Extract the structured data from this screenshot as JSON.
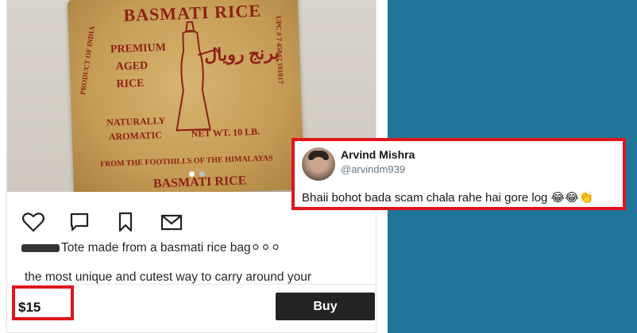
{
  "product": {
    "image_texts": {
      "brand": "BASMATI RICE",
      "line1": "PREMIUM",
      "line2": "AGED",
      "line3": "RICE",
      "naturally": "NATURALLY",
      "aromatic": "AROMATIC",
      "net_wt": "NET WT. 10 LB.",
      "foothills": "FROM THE FOOTHILLS OF THE HIMALAYAS",
      "product_of": "PRODUCT OF INDIA",
      "upc": "UPC # 7 45042 101017",
      "arabic": "برنج رويال",
      "bottom": "BASMATI RICE"
    },
    "caption_line1": "Tote made from a basmati rice bag",
    "caption_emojis": "⚪⚪⚪",
    "caption_line2": "the most unique and cutest way to carry around your",
    "price": "$15",
    "buy_label": "Buy"
  },
  "icons": {
    "like": "heart-icon",
    "comment": "comment-icon",
    "save": "bookmark-icon",
    "share": "envelope-icon"
  },
  "tweet": {
    "name": "Arvind Mishra",
    "handle": "@arvindm939",
    "text": "Bhaii bohot bada scam chala rahe hai gore log",
    "emojis": "😂😂👏"
  },
  "colors": {
    "highlight": "#e0141c",
    "right_background": "#1f7698",
    "buy_button": "#232323"
  }
}
